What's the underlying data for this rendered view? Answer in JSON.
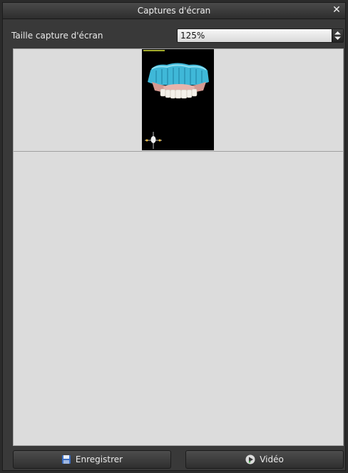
{
  "window": {
    "title": "Captures d'écran",
    "close_glyph": "✕"
  },
  "settings": {
    "size_label": "Taille capture d'écran",
    "size_value": "125%"
  },
  "screenshots": [
    {
      "kind": "3d-dental-view",
      "overlay_text": ""
    }
  ],
  "buttons": {
    "save_label": "Enregistrer",
    "save_icon": "floppy-disk-icon",
    "video_label": "Vidéo",
    "video_icon": "play-icon"
  },
  "colors": {
    "gum": "#e0a8a0",
    "teeth": "#f4f1ea",
    "guide": "#3fb8d8"
  }
}
